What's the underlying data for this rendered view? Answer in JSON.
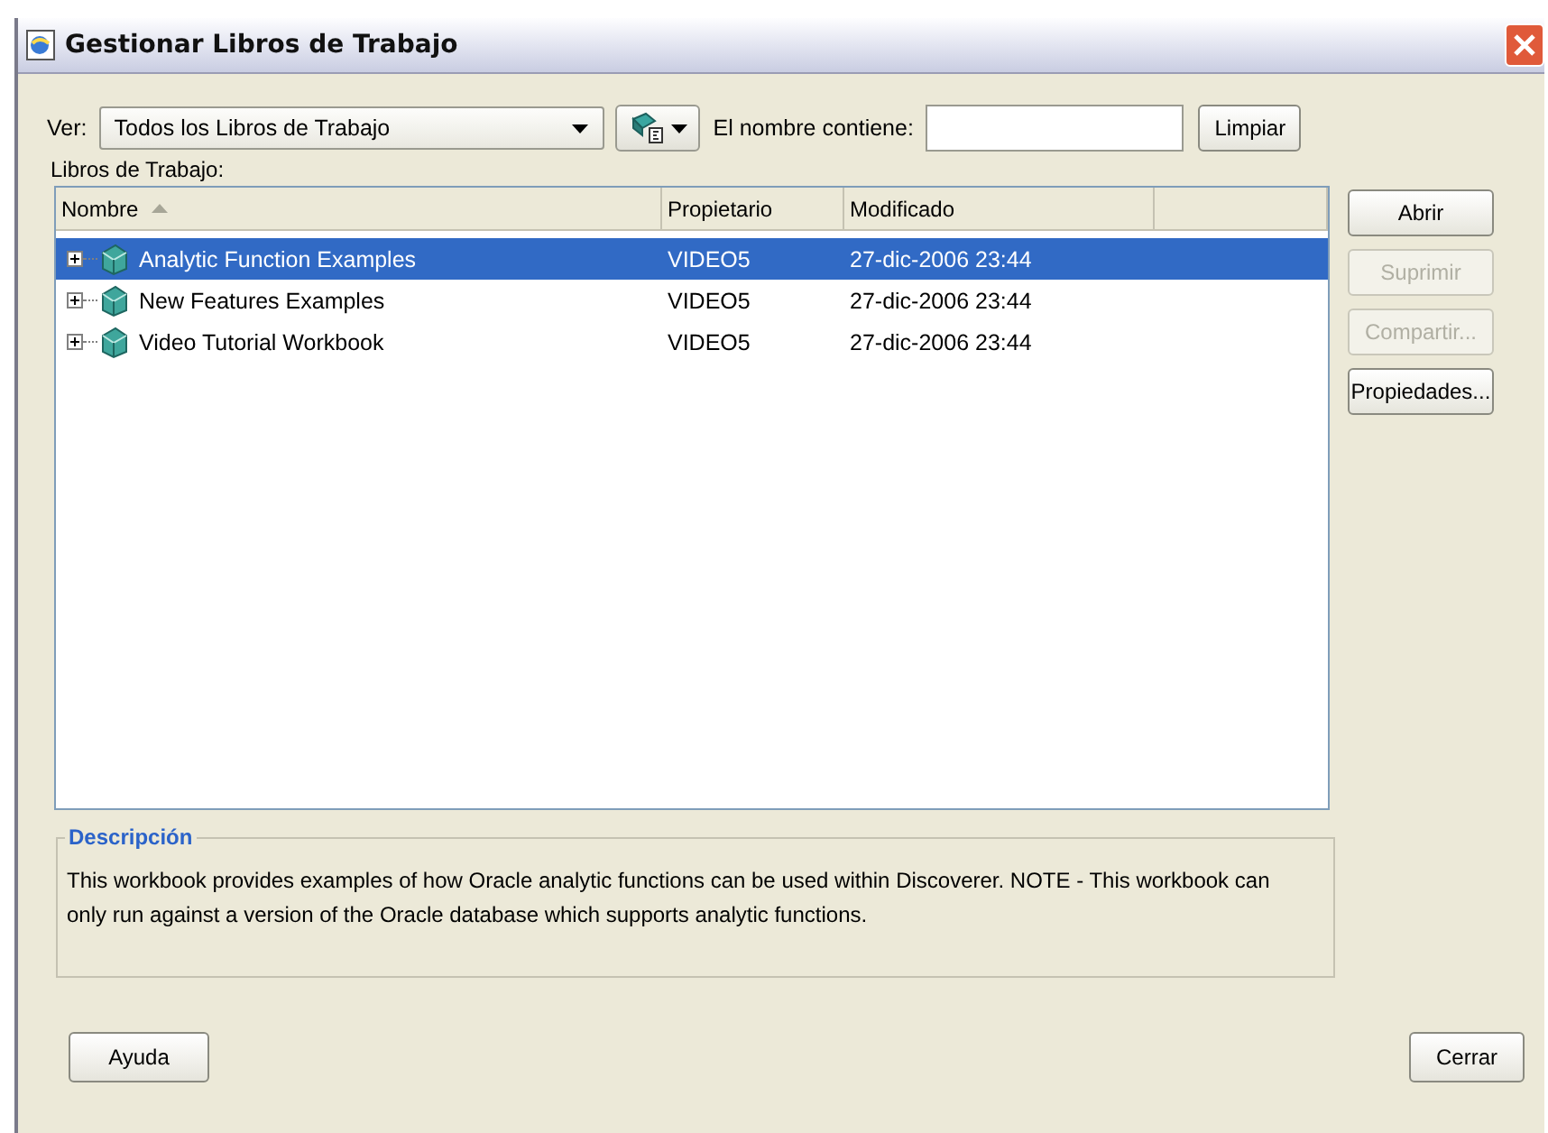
{
  "window": {
    "title": "Gestionar Libros de Trabajo"
  },
  "filter": {
    "view_label": "Ver:",
    "view_value": "Todos los Libros de Trabajo",
    "name_label": "El nombre contiene:",
    "clear_button": "Limpiar"
  },
  "list_label": "Libros de Trabajo:",
  "table": {
    "columns": [
      {
        "label": "Nombre",
        "sorted": true
      },
      {
        "label": "Propietario",
        "sorted": false
      },
      {
        "label": "Modificado",
        "sorted": false
      }
    ],
    "rows": [
      {
        "name": "Analytic Function Examples",
        "owner": "VIDEO5",
        "modified": "27-dic-2006 23:44",
        "selected": true
      },
      {
        "name": "New Features Examples",
        "owner": "VIDEO5",
        "modified": "27-dic-2006 23:44",
        "selected": false
      },
      {
        "name": "Video Tutorial Workbook",
        "owner": "VIDEO5",
        "modified": "27-dic-2006 23:44",
        "selected": false
      }
    ]
  },
  "side_buttons": [
    {
      "label": "Abrir",
      "disabled": false
    },
    {
      "label": "Suprimir",
      "disabled": true
    },
    {
      "label": "Compartir...",
      "disabled": true
    },
    {
      "label": "Propiedades...",
      "disabled": false
    }
  ],
  "description": {
    "title": "Descripción",
    "text": "This workbook provides examples of how Oracle analytic functions can be used within Discoverer. NOTE - This workbook can only run against a version of the Oracle database which supports analytic functions."
  },
  "footer": {
    "help_button": "Ayuda",
    "close_button": "Cerrar"
  }
}
